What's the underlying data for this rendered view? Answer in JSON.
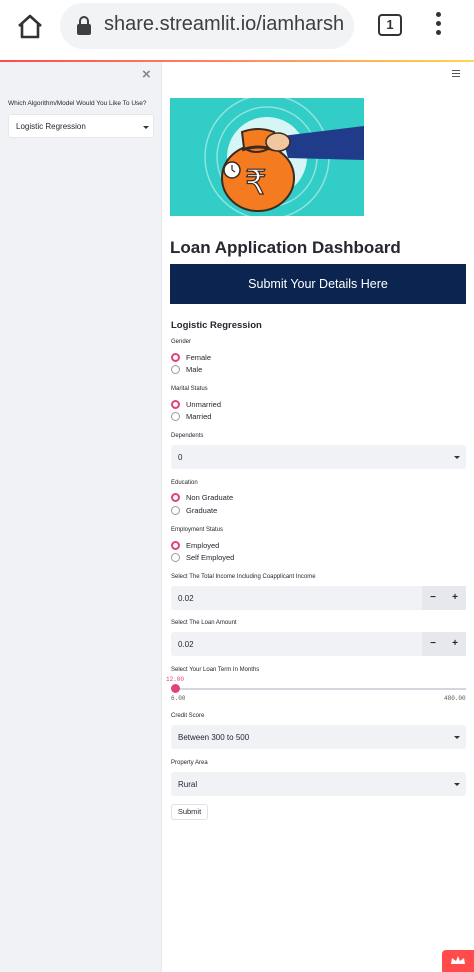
{
  "browser": {
    "url": "share.streamlit.io/iamharsh",
    "tab_count": "1"
  },
  "sidebar": {
    "close_icon": "×",
    "model_label": "Which Algorithm/Model Would You Like To Use?",
    "model_value": "Logistic Regression"
  },
  "main": {
    "title": "Loan Application Dashboard",
    "banner": "Submit Your Details Here",
    "section_title": "Logistic Regression",
    "gender": {
      "label": "Gender",
      "options": [
        "Female",
        "Male"
      ],
      "selected": "Female"
    },
    "marital": {
      "label": "Marital Status",
      "options": [
        "Unmarried",
        "Married"
      ],
      "selected": "Unmarried"
    },
    "dependents": {
      "label": "Dependents",
      "value": "0"
    },
    "education": {
      "label": "Education",
      "options": [
        "Non Graduate",
        "Graduate"
      ],
      "selected": "Non Graduate"
    },
    "employment": {
      "label": "Employment Status",
      "options": [
        "Employed",
        "Self Employed"
      ],
      "selected": "Employed"
    },
    "income": {
      "label": "Select The Total Income Including Coapplicant Income",
      "value": "0.02",
      "minus": "−",
      "plus": "+"
    },
    "loan_amount": {
      "label": "Select The Loan Amount",
      "value": "0.02",
      "minus": "−",
      "plus": "+"
    },
    "loan_term": {
      "label": "Select Your Loan Term In Months",
      "current": "12.00",
      "min": "6.00",
      "max": "480.00",
      "fraction": 0.013
    },
    "credit_score": {
      "label": "Credit Score",
      "value": "Between 300 to 500"
    },
    "property_area": {
      "label": "Property Area",
      "value": "Rural"
    },
    "submit": "Submit"
  },
  "colors": {
    "accent": "#e0427a",
    "banner": "#0b2550",
    "hero_bg": "#32cdc6",
    "sidebar_bg": "#f0f2f6"
  }
}
